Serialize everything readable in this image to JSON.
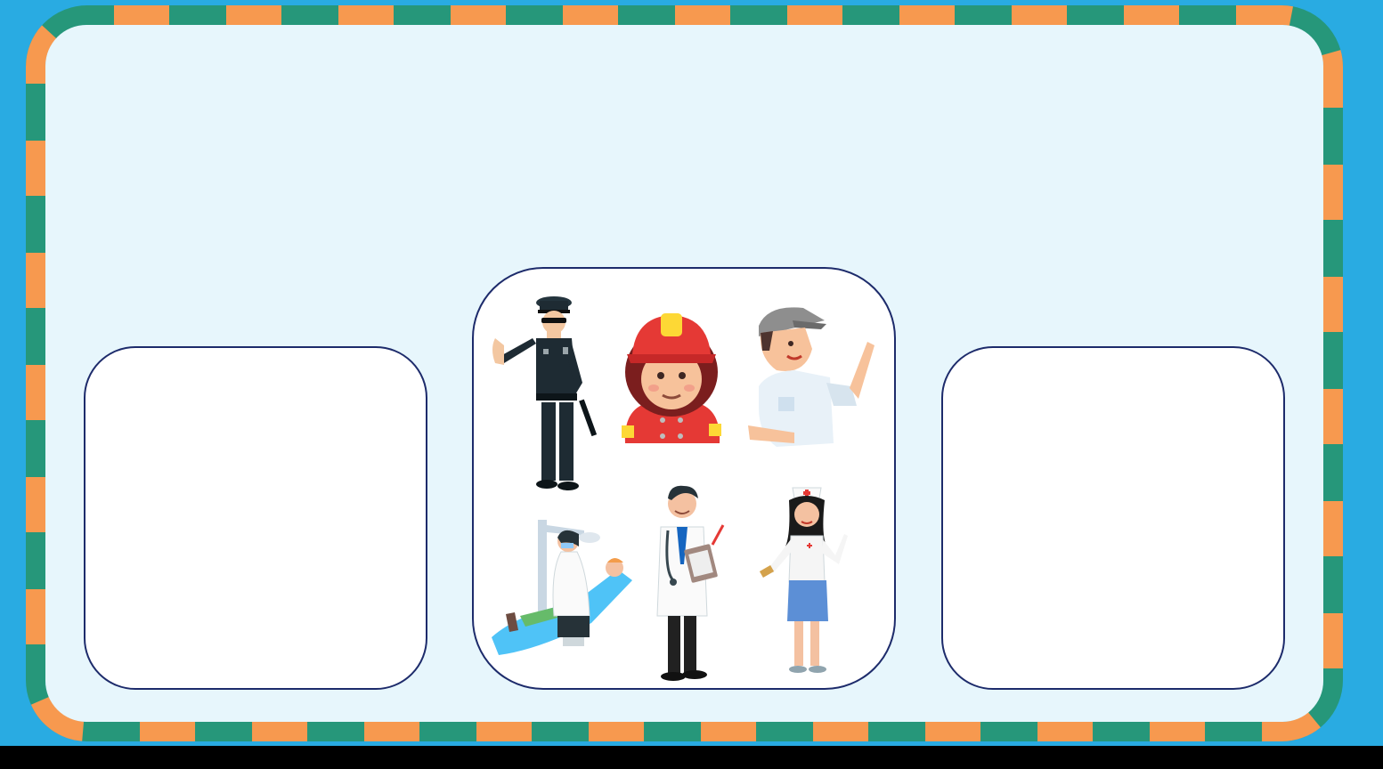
{
  "colors": {
    "outer_background": "#29abe2",
    "frame_green": "#26977a",
    "frame_orange": "#f7994f",
    "board_background": "#e7f6fc",
    "box_border": "#1d2b6b"
  },
  "boards": {
    "left_box": {
      "contents": []
    },
    "right_box": {
      "contents": []
    }
  },
  "job_cards": [
    {
      "icon": "police-officer-icon"
    },
    {
      "icon": "firefighter-icon"
    },
    {
      "icon": "traffic-officer-icon"
    },
    {
      "icon": "dentist-icon"
    },
    {
      "icon": "doctor-icon"
    },
    {
      "icon": "nurse-icon"
    }
  ]
}
